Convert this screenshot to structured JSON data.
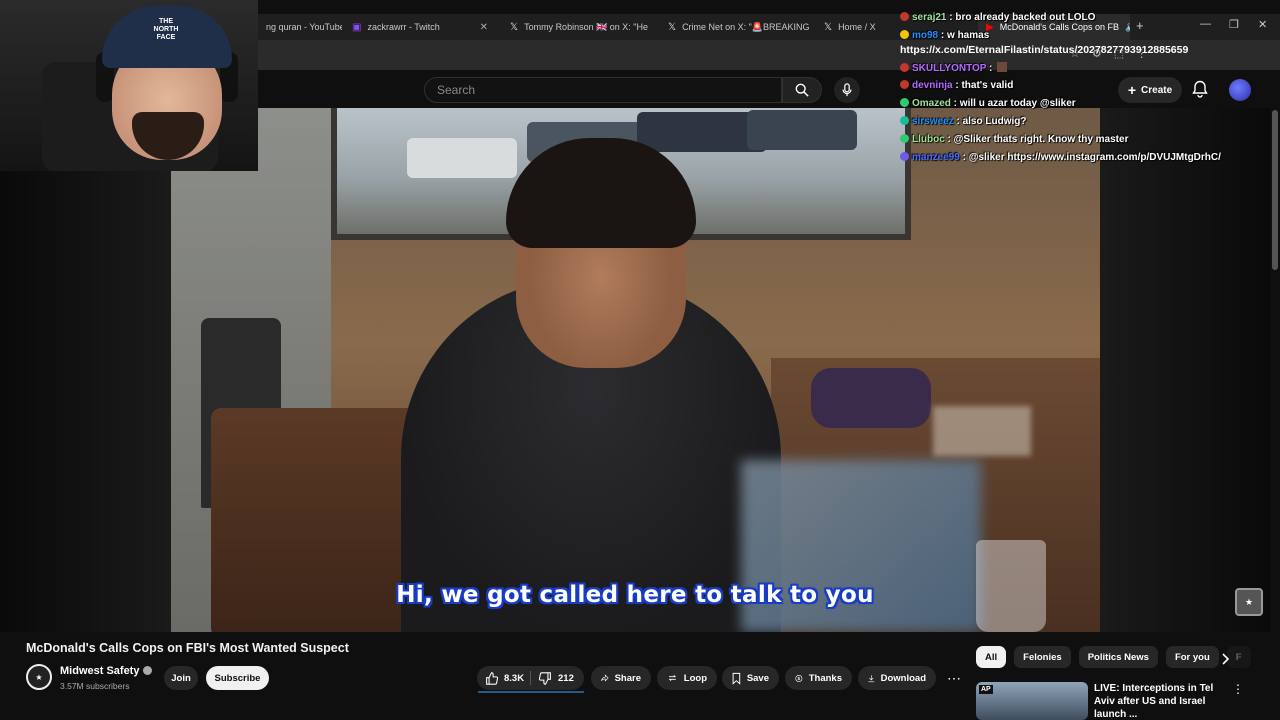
{
  "browser": {
    "tabs": [
      {
        "label": "ng quran - YouTube",
        "icon": "youtube-icon"
      },
      {
        "label": "zackrawrr - Twitch",
        "icon": "twitch-icon"
      },
      {
        "label": "Tommy Robinson 🇬🇧 on X: \"He",
        "icon": "x-icon"
      },
      {
        "label": "Crime Net on X: \"🚨BREAKING",
        "icon": "x-icon"
      },
      {
        "label": "Home / X",
        "icon": "x-icon"
      },
      {
        "label": "McDonald's Calls Cops on FB",
        "icon": "youtube-icon"
      }
    ],
    "url": "https://x.com/EternalFilastin/status/2027827793912885659"
  },
  "youtube": {
    "search_placeholder": "Search",
    "create_label": "Create"
  },
  "video": {
    "subtitle": "Hi, we got called here to talk to you",
    "title": "McDonald's Calls Cops on FBI's Most Wanted Suspect",
    "channel": "Midwest Safety",
    "subscribers": "3.57M subscribers",
    "join_label": "Join",
    "subscribe_label": "Subscribe",
    "likes": "8.3K",
    "dislikes": "212",
    "actions": {
      "share": "Share",
      "loop": "Loop",
      "save": "Save",
      "thanks": "Thanks",
      "download": "Download"
    }
  },
  "webcam": {
    "beanie_logo": "THE NORTH FACE"
  },
  "chat": [
    {
      "user": "seraj21",
      "message": "bro already backed out LOLO",
      "color": "#9fe39a",
      "badge_color": "#c0392b"
    },
    {
      "user": "mo98",
      "message": "w hamas",
      "color": "#1e90ff",
      "badge_color": "#f1c40f"
    },
    {
      "user": "SKULLYONTOP",
      "message": "",
      "color": "#b36bff",
      "badge_color": "#c0392b"
    },
    {
      "user": "devninja",
      "message": "that's valid",
      "color": "#b36bff",
      "badge_color": "#c0392b"
    },
    {
      "user": "Omazed",
      "message": "will u azar today @sliker",
      "color": "#9fe39a",
      "badge_color": "#2ecc71"
    },
    {
      "user": "sirsweez",
      "message": "also Ludwig?",
      "color": "#1e90ff",
      "badge_color": "#1abc9c"
    },
    {
      "user": "Lluboc",
      "message": "@Sliker thats right. Know thy master",
      "color": "#9fe39a",
      "badge_color": "#2ecc71"
    },
    {
      "user": "manzee99",
      "message": "@sliker https://www.instagram.com/p/DVUJMtgDrhC/",
      "color": "#4a6bff",
      "badge_color": "#6c5ce7"
    }
  ],
  "chips": [
    "All",
    "Felonies",
    "Politics News",
    "For you",
    "F"
  ],
  "recommended": {
    "badge": "AP",
    "title": "LIVE: Interceptions in Tel Aviv after US and Israel launch ..."
  }
}
